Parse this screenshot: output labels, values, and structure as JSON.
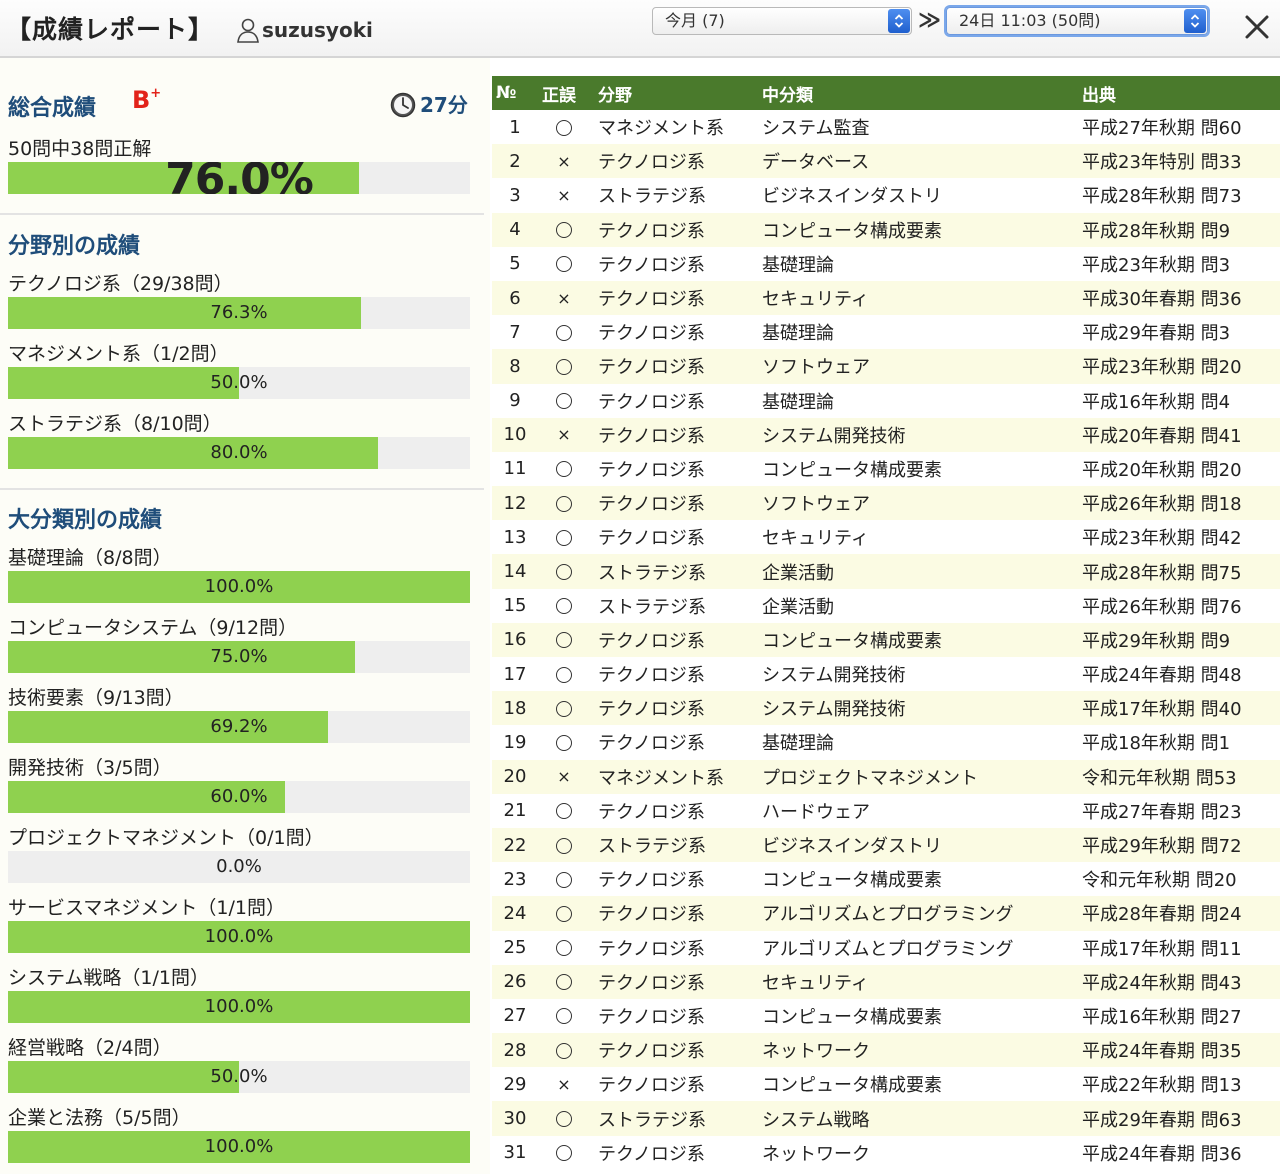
{
  "header": {
    "title": "【成績レポート】",
    "user": "suzusyoki",
    "month_select": "今月 (7)",
    "session_select": "24日 11:03 (50問)",
    "next_symbol": "≫"
  },
  "overall": {
    "title": "総合成績",
    "grade": "B",
    "grade_modifier": "+",
    "time": "27分",
    "caption": "50問中38問正解",
    "percent_label": "76.0%",
    "percent": 76.0
  },
  "field_section": {
    "title": "分野別の成績",
    "items": [
      {
        "label": "テクノロジ系（29/38問）",
        "percent_label": "76.3%",
        "percent": 76.3
      },
      {
        "label": "マネジメント系（1/2問）",
        "percent_label": "50.0%",
        "percent": 50.0
      },
      {
        "label": "ストラテジ系（8/10問）",
        "percent_label": "80.0%",
        "percent": 80.0
      }
    ]
  },
  "category_section": {
    "title": "大分類別の成績",
    "items": [
      {
        "label": "基礎理論（8/8問）",
        "percent_label": "100.0%",
        "percent": 100.0
      },
      {
        "label": "コンピュータシステム（9/12問）",
        "percent_label": "75.0%",
        "percent": 75.0
      },
      {
        "label": "技術要素（9/13問）",
        "percent_label": "69.2%",
        "percent": 69.2
      },
      {
        "label": "開発技術（3/5問）",
        "percent_label": "60.0%",
        "percent": 60.0
      },
      {
        "label": "プロジェクトマネジメント（0/1問）",
        "percent_label": "0.0%",
        "percent": 0.0
      },
      {
        "label": "サービスマネジメント（1/1問）",
        "percent_label": "100.0%",
        "percent": 100.0
      },
      {
        "label": "システム戦略（1/1問）",
        "percent_label": "100.0%",
        "percent": 100.0
      },
      {
        "label": "経営戦略（2/4問）",
        "percent_label": "50.0%",
        "percent": 50.0
      },
      {
        "label": "企業と法務（5/5問）",
        "percent_label": "100.0%",
        "percent": 100.0
      }
    ]
  },
  "table": {
    "headers": [
      "№",
      "正誤",
      "分野",
      "中分類",
      "出典"
    ],
    "rows": [
      {
        "no": "1",
        "ok": true,
        "field": "マネジメント系",
        "category": "システム監査",
        "source": "平成27年秋期 問60"
      },
      {
        "no": "2",
        "ok": false,
        "field": "テクノロジ系",
        "category": "データベース",
        "source": "平成23年特別 問33"
      },
      {
        "no": "3",
        "ok": false,
        "field": "ストラテジ系",
        "category": "ビジネスインダストリ",
        "source": "平成28年秋期 問73"
      },
      {
        "no": "4",
        "ok": true,
        "field": "テクノロジ系",
        "category": "コンピュータ構成要素",
        "source": "平成28年秋期 問9"
      },
      {
        "no": "5",
        "ok": true,
        "field": "テクノロジ系",
        "category": "基礎理論",
        "source": "平成23年秋期 問3"
      },
      {
        "no": "6",
        "ok": false,
        "field": "テクノロジ系",
        "category": "セキュリティ",
        "source": "平成30年春期 問36"
      },
      {
        "no": "7",
        "ok": true,
        "field": "テクノロジ系",
        "category": "基礎理論",
        "source": "平成29年春期 問3"
      },
      {
        "no": "8",
        "ok": true,
        "field": "テクノロジ系",
        "category": "ソフトウェア",
        "source": "平成23年秋期 問20"
      },
      {
        "no": "9",
        "ok": true,
        "field": "テクノロジ系",
        "category": "基礎理論",
        "source": "平成16年秋期 問4"
      },
      {
        "no": "10",
        "ok": false,
        "field": "テクノロジ系",
        "category": "システム開発技術",
        "source": "平成20年春期 問41"
      },
      {
        "no": "11",
        "ok": true,
        "field": "テクノロジ系",
        "category": "コンピュータ構成要素",
        "source": "平成20年秋期 問20"
      },
      {
        "no": "12",
        "ok": true,
        "field": "テクノロジ系",
        "category": "ソフトウェア",
        "source": "平成26年秋期 問18"
      },
      {
        "no": "13",
        "ok": true,
        "field": "テクノロジ系",
        "category": "セキュリティ",
        "source": "平成23年秋期 問42"
      },
      {
        "no": "14",
        "ok": true,
        "field": "ストラテジ系",
        "category": "企業活動",
        "source": "平成28年秋期 問75"
      },
      {
        "no": "15",
        "ok": true,
        "field": "ストラテジ系",
        "category": "企業活動",
        "source": "平成26年秋期 問76"
      },
      {
        "no": "16",
        "ok": true,
        "field": "テクノロジ系",
        "category": "コンピュータ構成要素",
        "source": "平成29年秋期 問9"
      },
      {
        "no": "17",
        "ok": true,
        "field": "テクノロジ系",
        "category": "システム開発技術",
        "source": "平成24年春期 問48"
      },
      {
        "no": "18",
        "ok": true,
        "field": "テクノロジ系",
        "category": "システム開発技術",
        "source": "平成17年秋期 問40"
      },
      {
        "no": "19",
        "ok": true,
        "field": "テクノロジ系",
        "category": "基礎理論",
        "source": "平成18年秋期 問1"
      },
      {
        "no": "20",
        "ok": false,
        "field": "マネジメント系",
        "category": "プロジェクトマネジメント",
        "source": "令和元年秋期 問53"
      },
      {
        "no": "21",
        "ok": true,
        "field": "テクノロジ系",
        "category": "ハードウェア",
        "source": "平成27年春期 問23"
      },
      {
        "no": "22",
        "ok": true,
        "field": "ストラテジ系",
        "category": "ビジネスインダストリ",
        "source": "平成29年秋期 問72"
      },
      {
        "no": "23",
        "ok": true,
        "field": "テクノロジ系",
        "category": "コンピュータ構成要素",
        "source": "令和元年秋期 問20"
      },
      {
        "no": "24",
        "ok": true,
        "field": "テクノロジ系",
        "category": "アルゴリズムとプログラミング",
        "source": "平成28年春期 問24"
      },
      {
        "no": "25",
        "ok": true,
        "field": "テクノロジ系",
        "category": "アルゴリズムとプログラミング",
        "source": "平成17年秋期 問11"
      },
      {
        "no": "26",
        "ok": true,
        "field": "テクノロジ系",
        "category": "セキュリティ",
        "source": "平成24年秋期 問43"
      },
      {
        "no": "27",
        "ok": true,
        "field": "テクノロジ系",
        "category": "コンピュータ構成要素",
        "source": "平成16年秋期 問27"
      },
      {
        "no": "28",
        "ok": true,
        "field": "テクノロジ系",
        "category": "ネットワーク",
        "source": "平成24年春期 問35"
      },
      {
        "no": "29",
        "ok": false,
        "field": "テクノロジ系",
        "category": "コンピュータ構成要素",
        "source": "平成22年秋期 問13"
      },
      {
        "no": "30",
        "ok": true,
        "field": "ストラテジ系",
        "category": "システム戦略",
        "source": "平成29年春期 問63"
      },
      {
        "no": "31",
        "ok": true,
        "field": "テクノロジ系",
        "category": "ネットワーク",
        "source": "平成24年春期 問36"
      }
    ]
  },
  "icons": {
    "user": "user-outline-icon",
    "select_arrow": "up-down-chevron-icon",
    "next": "double-chevron-right-icon",
    "close": "close-icon",
    "clock": "clock-icon",
    "correct": "circle-mark-icon",
    "wrong": "cross-mark-icon"
  },
  "colors": {
    "bar_fill": "#8fd14f",
    "table_header": "#4a7a2c",
    "section_title": "#1f4d7a",
    "grade": "#e2231a",
    "alt_row": "#fbfbe3"
  }
}
